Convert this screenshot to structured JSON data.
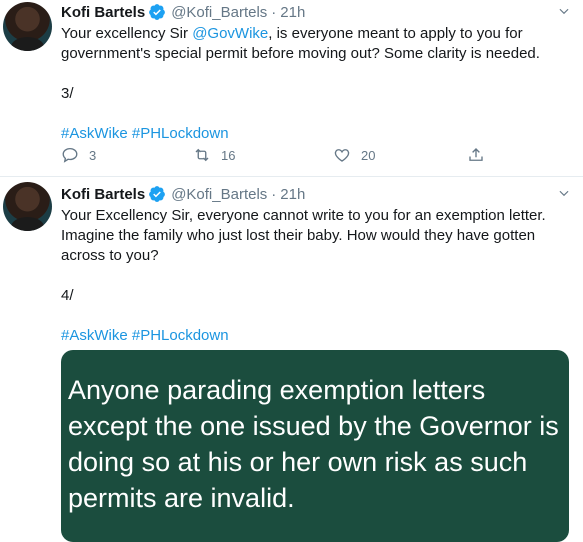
{
  "tweets": [
    {
      "author_name": "Kofi Bartels",
      "handle": "@Kofi_Bartels",
      "separator": "·",
      "time": "21h",
      "text_before_mention": "Your excellency Sir ",
      "mention": "@GovWike",
      "text_after_mention": ", is everyone meant to apply to you for government's special permit before moving out? Some clarity is needed.",
      "thread_index": "3/",
      "hashtags": "#AskWike #PHLockdown",
      "reply_count": "3",
      "retweet_count": "16",
      "like_count": "20"
    },
    {
      "author_name": "Kofi Bartels",
      "handle": "@Kofi_Bartels",
      "separator": "·",
      "time": "21h",
      "text": "Your Excellency Sir, everyone cannot write to you for an exemption letter. Imagine the family who just lost their baby. How would they have gotten across to you?",
      "thread_index": "4/",
      "hashtags": "#AskWike #PHLockdown",
      "media_text": "Anyone parading exemption letters except the one issued by the Governor is doing so at his or her own risk as such permits are invalid.",
      "media_color": "#1b4d3e"
    }
  ],
  "icons": [
    "verified-icon",
    "caret-down-icon",
    "reply-icon",
    "retweet-icon",
    "like-icon",
    "share-icon"
  ],
  "colors": {
    "link": "#1b95e0",
    "secondary": "#657786",
    "text": "#14171a"
  }
}
